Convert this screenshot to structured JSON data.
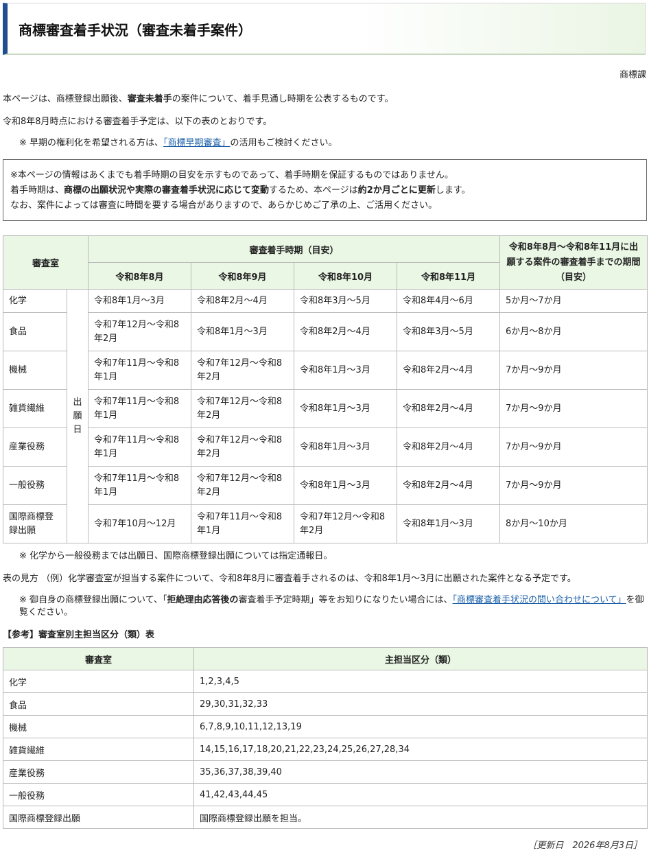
{
  "header": {
    "title": "商標審査着手状況（審査未着手案件）"
  },
  "department": "商標課",
  "intro": {
    "p1_pre": "本ページは、商標登録出願後、",
    "p1_bold": "審査未着手",
    "p1_post": "の案件について、着手見通し時期を公表するものです。",
    "p2": "令和8年8月時点における審査着手予定は、以下の表のとおりです。",
    "p3_pre": "※ 早期の権利化を希望される方は、",
    "p3_link": "「商標早期審査」",
    "p3_post": "の活用もご検討ください。"
  },
  "notice": {
    "line1": "※本ページの情報はあくまでも着手時期の目安を示すものであって、着手時期を保証するものではありません。",
    "line2_a": "着手時期は、",
    "line2_b": "商標の出願状況や実際の審査着手状況に応じて変動",
    "line2_c": "するため、本ページは",
    "line2_d": "約2か月ごとに更新",
    "line2_e": "します。",
    "line3": "なお、案件によっては審査に時間を要する場合がありますので、あらかじめご了承の上、ご活用ください。"
  },
  "schedule_table": {
    "header_room": "審査室",
    "header_period": "審査着手時期（目安）",
    "header_duration": "令和8年8月～令和8年11月に出願する案件の審査着手までの期間（目安）",
    "months": [
      "令和8年8月",
      "令和8年9月",
      "令和8年10月",
      "令和8年11月"
    ],
    "basis": [
      "出",
      "願",
      "日"
    ],
    "rows": [
      {
        "room": "化学",
        "m": [
          "令和8年1月～3月",
          "令和8年2月～4月",
          "令和8年3月～5月",
          "令和8年4月～6月"
        ],
        "duration": "5か月～7か月"
      },
      {
        "room": "食品",
        "m": [
          "令和7年12月～令和8年2月",
          "令和8年1月～3月",
          "令和8年2月～4月",
          "令和8年3月～5月"
        ],
        "duration": "6か月～8か月"
      },
      {
        "room": "機械",
        "m": [
          "令和7年11月～令和8年1月",
          "令和7年12月～令和8年2月",
          "令和8年1月～3月",
          "令和8年2月～4月"
        ],
        "duration": "7か月～9か月"
      },
      {
        "room": "雑貨繊維",
        "m": [
          "令和7年11月～令和8年1月",
          "令和7年12月～令和8年2月",
          "令和8年1月～3月",
          "令和8年2月～4月"
        ],
        "duration": "7か月～9か月"
      },
      {
        "room": "産業役務",
        "m": [
          "令和7年11月～令和8年1月",
          "令和7年12月～令和8年2月",
          "令和8年1月～3月",
          "令和8年2月～4月"
        ],
        "duration": "7か月～9か月"
      },
      {
        "room": "一般役務",
        "m": [
          "令和7年11月～令和8年1月",
          "令和7年12月～令和8年2月",
          "令和8年1月～3月",
          "令和8年2月～4月"
        ],
        "duration": "7か月～9か月"
      },
      {
        "room": "国際商標登録出願",
        "m": [
          "令和7年10月～12月",
          "令和7年11月～令和8年1月",
          "令和7年12月～令和8年2月",
          "令和8年1月～3月"
        ],
        "duration": "8か月～10か月"
      }
    ]
  },
  "footnote": "※ 化学から一般役務までは出願日、国際商標登録出願については指定通報日。",
  "howto": "表の見方 （例）化学審査室が担当する案件について、令和8年8月に審査着手されるのは、令和8年1月～3月に出願された案件となる予定です。",
  "inquiry": {
    "pre": "※ 御自身の商標登録出願について、「",
    "bold": "拒絶理由応答後の",
    "mid": "審査着手予定時期」等をお知りになりたい場合には、",
    "link": "「商標審査着手状況の問い合わせについて」",
    "post": "を御覧ください。"
  },
  "reference": {
    "title": "【参考】審査室別主担当区分（類）表",
    "header_room": "審査室",
    "header_class": "主担当区分（類）",
    "rows": [
      {
        "room": "化学",
        "classes": "1,2,3,4,5"
      },
      {
        "room": "食品",
        "classes": "29,30,31,32,33"
      },
      {
        "room": "機械",
        "classes": "6,7,8,9,10,11,12,13,19"
      },
      {
        "room": "雑貨繊維",
        "classes": "14,15,16,17,18,20,21,22,23,24,25,26,27,28,34"
      },
      {
        "room": "産業役務",
        "classes": "35,36,37,38,39,40"
      },
      {
        "room": "一般役務",
        "classes": "41,42,43,44,45"
      },
      {
        "room": "国際商標登録出願",
        "classes": "国際商標登録出願を担当。"
      }
    ]
  },
  "updated": "［更新日　2026年8月3日］"
}
